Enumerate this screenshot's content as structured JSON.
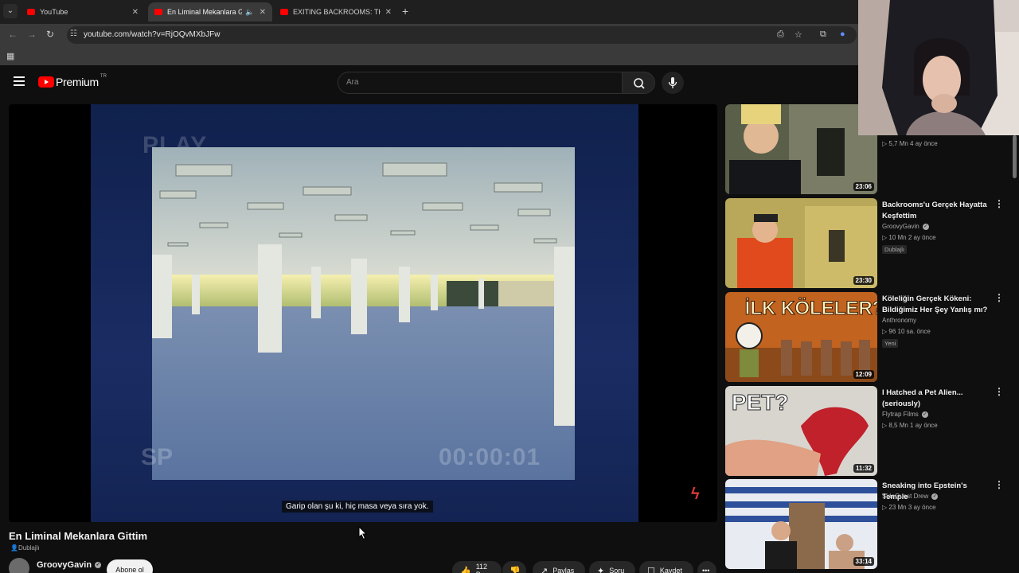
{
  "browser": {
    "tabs": [
      {
        "title": "YouTube",
        "active": false
      },
      {
        "title": "En Liminal Mekanlara Gittim",
        "active": true
      },
      {
        "title": "EXITING BACKROOMS: THE END",
        "active": false
      }
    ],
    "url": "youtube.com/watch?v=RjOQvMXbJFw"
  },
  "youtube": {
    "brand": "Premium",
    "country": "TR",
    "search_placeholder": "Ara"
  },
  "player": {
    "vhs_play": "PLAY",
    "vhs_mode": "SP",
    "vhs_time": "00:00:01",
    "caption": "Garip olan şu ki, hiç masa veya sıra yok."
  },
  "video": {
    "title": "En Liminal Mekanlara Gittim",
    "dubbed_label": "Dublajlı",
    "channel": "GroovyGavin",
    "subscribe_label": "Abone ol",
    "like_count": "112 B",
    "share_label": "Paylaş",
    "ask_label": "Soru",
    "save_label": "Kaydet"
  },
  "recommendations": [
    {
      "title": "",
      "channel": "",
      "meta": "▷ 5,7 Mn   4 ay önce",
      "badge": "",
      "duration": "23:06"
    },
    {
      "title": "Backrooms'u Gerçek Hayatta Keşfettim",
      "channel": "GroovyGavin",
      "meta": "▷ 10 Mn   2 ay önce",
      "badge": "Dublajlı",
      "duration": "23:30"
    },
    {
      "title": "Köleliğin Gerçek Kökeni: Bildiğimiz Her Şey Yanlış mı?",
      "channel": "Anthronomy",
      "meta": "▷ 96   10 sa. önce",
      "badge": "Yeni",
      "duration": "12:09",
      "thumb_text": "İLK KÖLELER?"
    },
    {
      "title": "I Hatched a Pet Alien... (seriously)",
      "channel": "Flytrap Films",
      "meta": "▷ 8,5 Mn   1 ay önce",
      "badge": "",
      "duration": "11:32",
      "thumb_text": "PET?"
    },
    {
      "title": "Sneaking into Epstein's Temple",
      "channel": "SideQuest Drew",
      "meta": "▷ 23 Mn   3 ay önce",
      "badge": "",
      "duration": "33:14"
    }
  ],
  "colors": {
    "youtube_red": "#ff0000",
    "background": "#0f0f0f",
    "chip": "#272727"
  }
}
